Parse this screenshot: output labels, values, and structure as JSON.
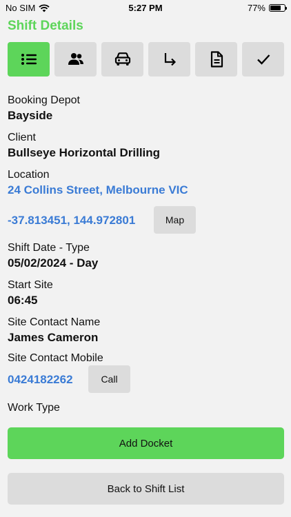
{
  "status": {
    "carrier": "No SIM",
    "time": "5:27 PM",
    "battery": "77%",
    "battery_level": 0.77
  },
  "header": {
    "title": "Shift Details"
  },
  "toolbar": {
    "tabs": [
      {
        "icon": "list-icon",
        "active": true
      },
      {
        "icon": "people-icon",
        "active": false
      },
      {
        "icon": "car-icon",
        "active": false
      },
      {
        "icon": "turn-arrow-icon",
        "active": false
      },
      {
        "icon": "document-icon",
        "active": false
      },
      {
        "icon": "checkmark-icon",
        "active": false
      }
    ]
  },
  "details": {
    "booking_depot_label": "Booking Depot",
    "booking_depot_value": "Bayside",
    "client_label": "Client",
    "client_value": "Bullseye Horizontal Drilling",
    "location_label": "Location",
    "location_value": "24 Collins Street, Melbourne VIC",
    "coordinates_value": "-37.813451, 144.972801",
    "map_button": "Map",
    "shift_date_label": "Shift Date - Type",
    "shift_date_value": "05/02/2024 - Day",
    "start_site_label": "Start Site",
    "start_site_value": "06:45",
    "contact_name_label": "Site Contact Name",
    "contact_name_value": "James Cameron",
    "contact_mobile_label": "Site Contact Mobile",
    "contact_mobile_value": "0424182262",
    "call_button": "Call",
    "work_type_label": "Work Type"
  },
  "actions": {
    "add_docket": "Add Docket",
    "back_to_list": "Back to Shift List"
  },
  "colors": {
    "accent_green": "#5dd55a",
    "link_blue": "#3a7bd5",
    "button_grey": "#dcdcdc",
    "background": "#f2f2f2"
  }
}
